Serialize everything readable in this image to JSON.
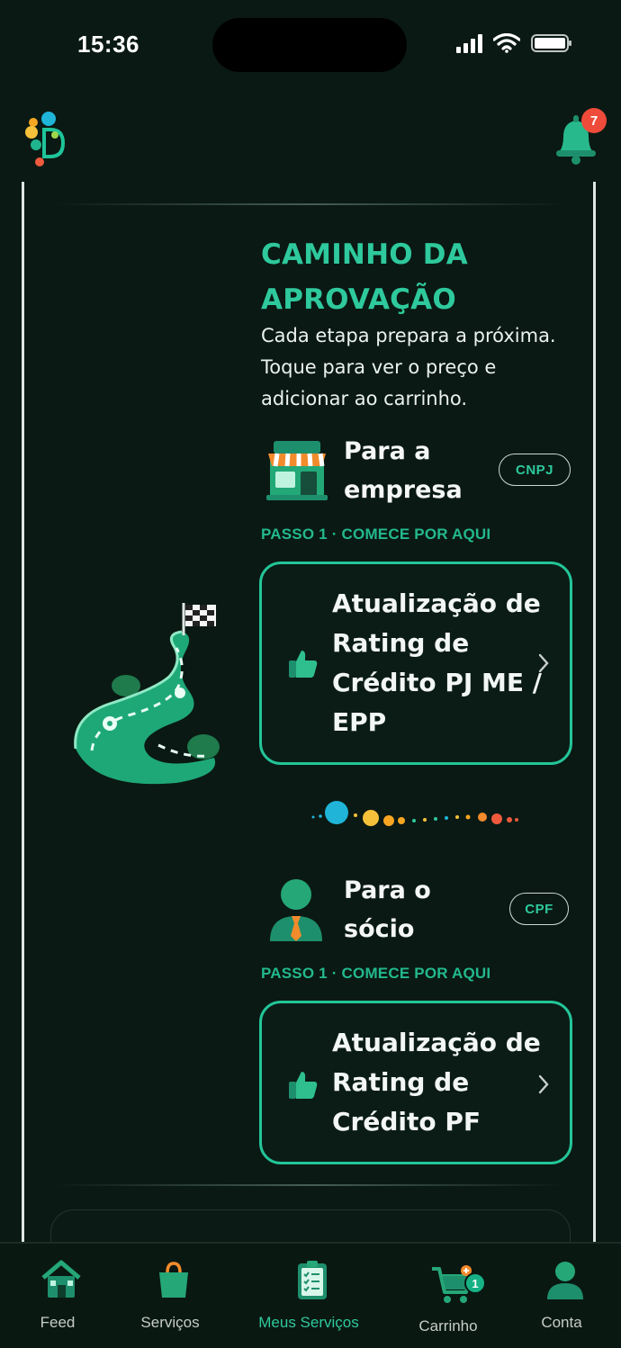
{
  "status_bar": {
    "time": "15:36"
  },
  "header": {
    "logo_icon": "app-logo-icon",
    "notifications_icon": "bell-icon",
    "notifications_count": "7"
  },
  "section": {
    "title": "CAMINHO DA APROVAÇÃO",
    "subtitle": "Cada etapa prepara a próxima. Toque para ver o preço e adicionar ao carrinho."
  },
  "groups": [
    {
      "icon": "storefront-icon",
      "title": "Para a empresa",
      "tag": "CNPJ",
      "step_label": "PASSO 1 · COMECE POR AQUI",
      "card": {
        "icon": "thumbs-up-icon",
        "text": "Atualização de Rating de Crédito PJ ME / EPP"
      }
    },
    {
      "icon": "person-icon",
      "title": "Para o sócio",
      "tag": "CPF",
      "step_label": "PASSO 1 · COMECE POR AQUI",
      "card": {
        "icon": "thumbs-up-icon",
        "text": "Atualização de Rating de Crédito PF"
      }
    }
  ],
  "illustration": "winding-road-flag-icon",
  "tabbar": {
    "active": "Meus Serviços",
    "items": [
      {
        "label": "Feed",
        "icon": "house-icon"
      },
      {
        "label": "Serviços",
        "icon": "shopping-bag-icon"
      },
      {
        "label": "Meus Serviços",
        "icon": "clipboard-checklist-icon"
      },
      {
        "label": "Carrinho",
        "icon": "cart-icon",
        "badge": "1"
      },
      {
        "label": "Conta",
        "icon": "user-icon"
      }
    ]
  },
  "colors": {
    "background": "#0a1913",
    "accent": "#2ec99c",
    "card_border": "#23c598",
    "badge_red": "#ef4b3a"
  }
}
